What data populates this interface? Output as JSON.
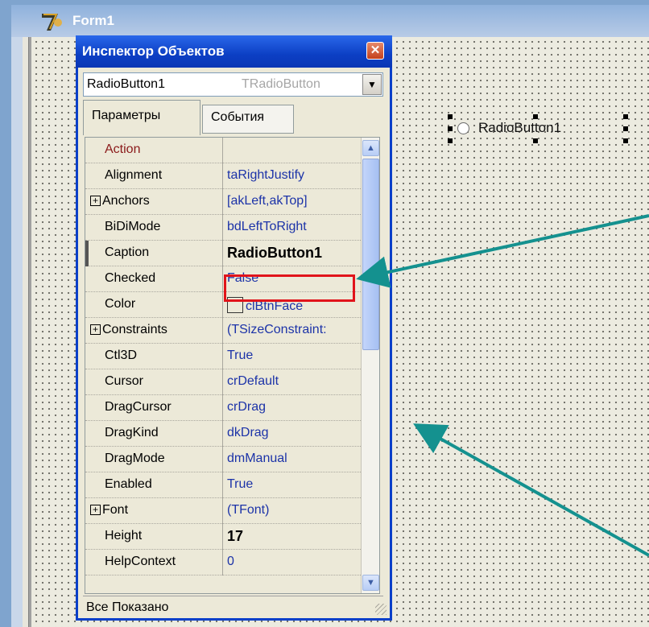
{
  "form": {
    "title": "Form1",
    "radio_caption": "RadioButton1"
  },
  "inspector": {
    "title": "Инспектор Объектов",
    "component_name": "RadioButton1",
    "component_type": "TRadioButton",
    "tabs": [
      "Параметры",
      "События"
    ],
    "status": "Все Показано",
    "properties": [
      {
        "name": "Action",
        "value": "",
        "expandable": false
      },
      {
        "name": "Alignment",
        "value": "taRightJustify",
        "expandable": false
      },
      {
        "name": "Anchors",
        "value": "[akLeft,akTop]",
        "expandable": true
      },
      {
        "name": "BiDiMode",
        "value": "bdLeftToRight",
        "expandable": false
      },
      {
        "name": "Caption",
        "value": "RadioButton1",
        "expandable": false
      },
      {
        "name": "Checked",
        "value": "False",
        "expandable": false
      },
      {
        "name": "Color",
        "value": "clBtnFace",
        "expandable": false
      },
      {
        "name": "Constraints",
        "value": "(TSizeConstraint:",
        "expandable": true
      },
      {
        "name": "Ctl3D",
        "value": "True",
        "expandable": false
      },
      {
        "name": "Cursor",
        "value": "crDefault",
        "expandable": false
      },
      {
        "name": "DragCursor",
        "value": "crDrag",
        "expandable": false
      },
      {
        "name": "DragKind",
        "value": "dkDrag",
        "expandable": false
      },
      {
        "name": "DragMode",
        "value": "dmManual",
        "expandable": false
      },
      {
        "name": "Enabled",
        "value": "True",
        "expandable": false
      },
      {
        "name": "Font",
        "value": "(TFont)",
        "expandable": true
      },
      {
        "name": "Height",
        "value": "17",
        "expandable": false
      },
      {
        "name": "HelpContext",
        "value": "0",
        "expandable": false
      }
    ]
  },
  "colors": {
    "title_bar": "#0c3fc4",
    "value_text": "#1c33a8",
    "highlight_box": "#e1141b",
    "arrow": "#14918f"
  }
}
